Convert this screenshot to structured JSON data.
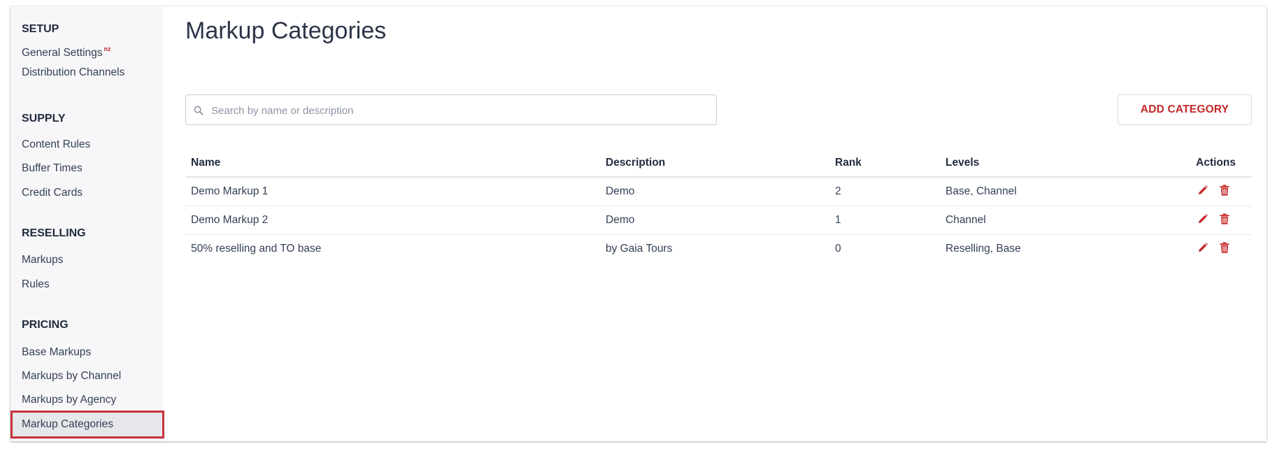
{
  "sidebar": {
    "sections": [
      {
        "title": "SETUP",
        "items": [
          {
            "label": "General Settings",
            "badge": "nz"
          },
          {
            "label": "Distribution Channels"
          }
        ]
      },
      {
        "title": "SUPPLY",
        "items": [
          {
            "label": "Content Rules"
          },
          {
            "label": "Buffer Times"
          },
          {
            "label": "Credit Cards"
          }
        ]
      },
      {
        "title": "RESELLING",
        "items": [
          {
            "label": "Markups"
          },
          {
            "label": "Rules"
          }
        ]
      },
      {
        "title": "PRICING",
        "items": [
          {
            "label": "Base Markups"
          },
          {
            "label": "Markups by Channel"
          },
          {
            "label": "Markups by Agency"
          },
          {
            "label": "Markup Categories",
            "active": true
          }
        ]
      }
    ]
  },
  "main": {
    "title": "Markup Categories",
    "search": {
      "placeholder": "Search by name or description",
      "value": ""
    },
    "add_button": "ADD CATEGORY",
    "table": {
      "headers": [
        "Name",
        "Description",
        "Rank",
        "Levels",
        "Actions"
      ],
      "rows": [
        [
          "Demo Markup 1",
          "Demo",
          "2",
          "Base, Channel"
        ],
        [
          "Demo Markup 2",
          "Demo",
          "1",
          "Channel"
        ],
        [
          "50% reselling and TO base",
          "by Gaia Tours",
          "0",
          "Reselling, Base"
        ]
      ]
    }
  },
  "colors": {
    "accent": "#c62828",
    "active_outline": "#c8323c",
    "sidebar_bg": "#f7f7f9",
    "text": "#2b3548"
  },
  "icons": {
    "search": "search-icon",
    "edit": "pencil-icon",
    "delete": "trash-icon"
  }
}
